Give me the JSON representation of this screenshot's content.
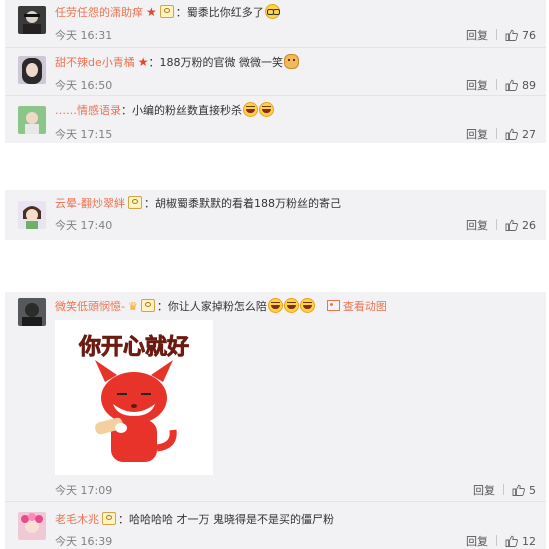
{
  "actions": {
    "reply": "回复"
  },
  "comments": [
    {
      "user": "任劳任怨的潇助痒",
      "text": "：蜀黍比你红多了",
      "time": "今天 16:31",
      "likes": "76"
    },
    {
      "user": "甜不辣de小青橘",
      "text": "：188万粉的官微 微微一笑",
      "time": "今天 16:50",
      "likes": "89"
    },
    {
      "user": "……情感语录",
      "text": "：小编的粉丝数直接秒杀",
      "time": "今天 17:15",
      "likes": "27"
    },
    {
      "user": "云晕-翻炒翠絆",
      "text": "：胡椒蜀黍默默的看着188万粉丝的寄己",
      "time": "今天 17:40",
      "likes": "26"
    },
    {
      "user": "微笑低頭悯憶-",
      "text": "：你让人家掉粉怎么陪",
      "view_anim": "查看动图",
      "sticker_text": "你开心就好",
      "time": "今天 17:09",
      "likes": "5"
    },
    {
      "user": "老毛木兆",
      "text": "：哈哈哈哈 才一万 鬼晓得是不是买的僵尸粉",
      "time": "今天 16:39",
      "likes": "12"
    }
  ],
  "colors": {
    "username": "#eb7350",
    "card_bg": "#f2f2f5",
    "sticker_red": "#e8332a"
  }
}
